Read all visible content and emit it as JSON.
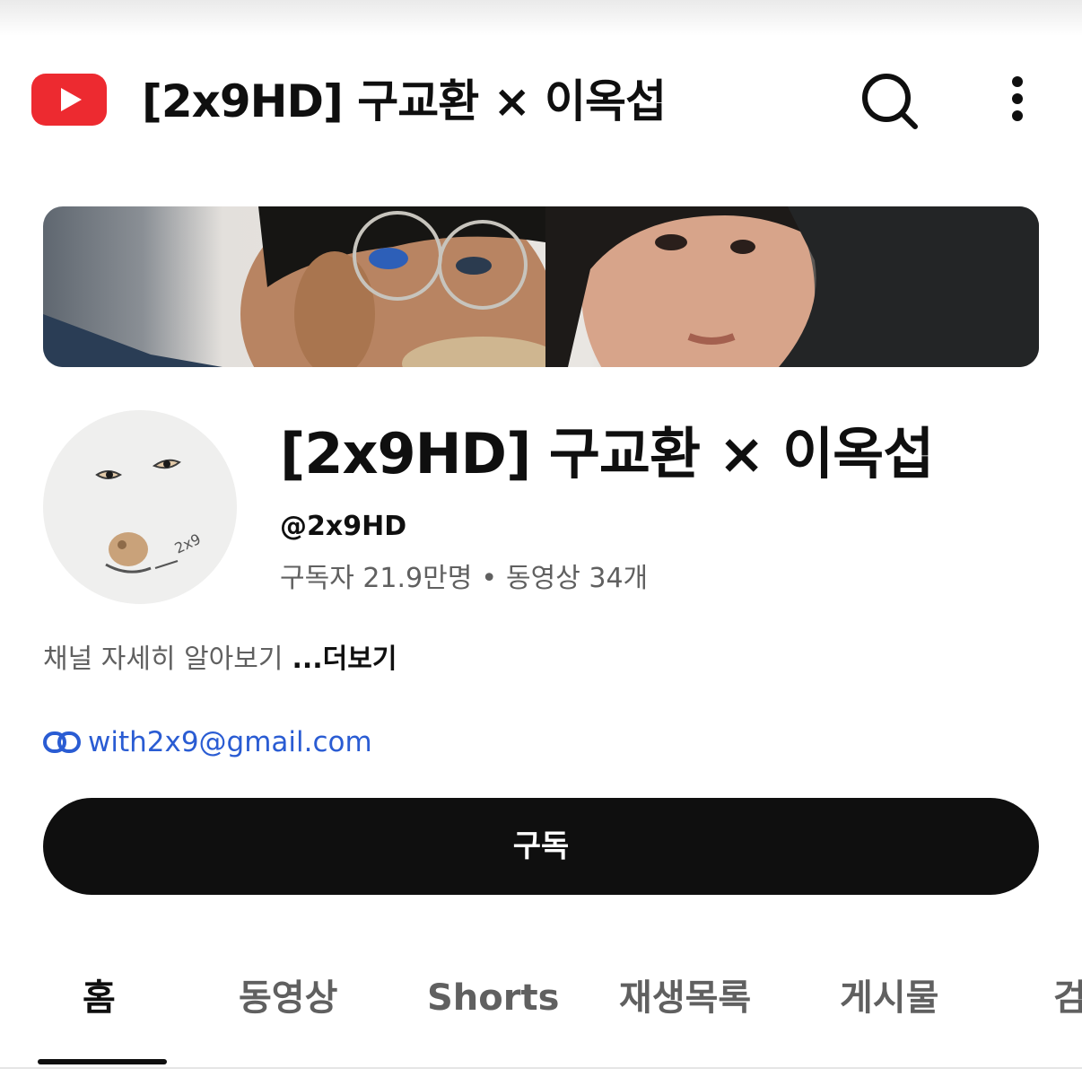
{
  "header": {
    "title": "[2x9HD] 구교환 × 이옥섭",
    "logo_icon": "youtube-logo-icon",
    "search_icon": "search-icon",
    "more_icon": "more-vertical-icon",
    "brand_color": "#ed2a30"
  },
  "channel": {
    "name": "[2x9HD] 구교환 × 이옥섭",
    "handle": "@2x9HD",
    "subscribers": "구독자 21.9만명",
    "separator": "•",
    "videos": "동영상 34개",
    "description": "채널 자세히 알아보기",
    "more_label": "...더보기",
    "link_icon": "link-icon",
    "link_text": "with2x9@gmail.com",
    "link_color": "#2a5cd3"
  },
  "subscribe": {
    "label": "구독"
  },
  "tabs": [
    {
      "label": "홈",
      "active": true
    },
    {
      "label": "동영상",
      "active": false
    },
    {
      "label": "Shorts",
      "active": false
    },
    {
      "label": "재생목록",
      "active": false
    },
    {
      "label": "게시물",
      "active": false
    },
    {
      "label": "검",
      "active": false
    }
  ]
}
